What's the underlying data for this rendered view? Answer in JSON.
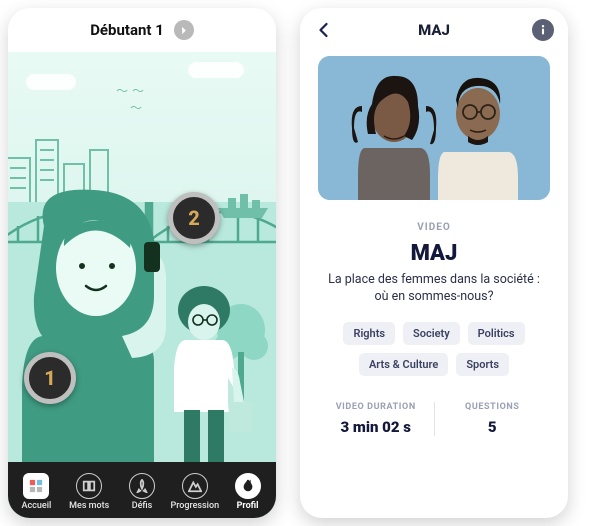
{
  "left": {
    "header_title": "Débutant 1",
    "levels": {
      "l1": "1",
      "l2": "2"
    },
    "tabs": [
      {
        "label": "Accueil"
      },
      {
        "label": "Mes mots"
      },
      {
        "label": "Défis"
      },
      {
        "label": "Progression"
      },
      {
        "label": "Profil"
      }
    ]
  },
  "right": {
    "header_title": "MAJ",
    "section_label": "VIDEO",
    "video_title": "MAJ",
    "video_description": "La place des femmes dans la société : où en sommes-nous?",
    "tags": [
      "Rights",
      "Society",
      "Politics",
      "Arts & Culture",
      "Sports"
    ],
    "stats": {
      "duration_label": "VIDEO DURATION",
      "duration_value": "3 min 02 s",
      "questions_label": "QUESTIONS",
      "questions_value": "5"
    }
  }
}
